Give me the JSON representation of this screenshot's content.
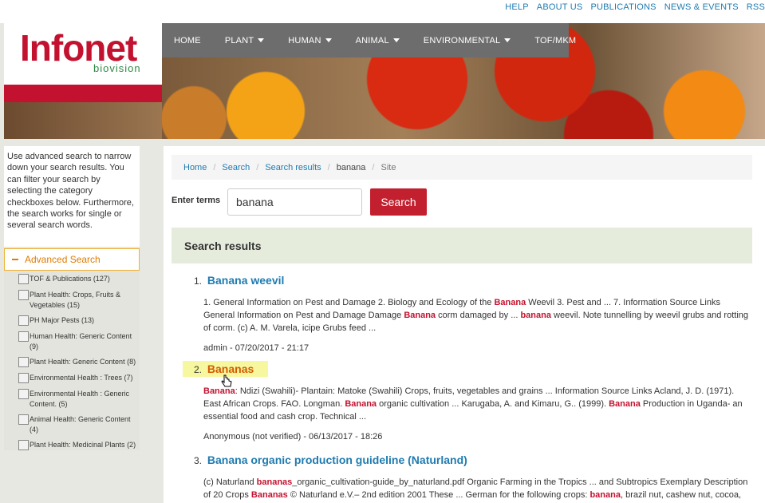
{
  "top_links": [
    "HELP",
    "ABOUT US",
    "PUBLICATIONS",
    "NEWS & EVENTS",
    "RSS"
  ],
  "logo": {
    "main": "Infonet",
    "sub": "biovision"
  },
  "nav": [
    {
      "label": "HOME",
      "dropdown": false
    },
    {
      "label": "PLANT",
      "dropdown": true
    },
    {
      "label": "HUMAN",
      "dropdown": true
    },
    {
      "label": "ANIMAL",
      "dropdown": true
    },
    {
      "label": "ENVIRONMENTAL",
      "dropdown": true
    },
    {
      "label": "TOF/MKM",
      "dropdown": false
    }
  ],
  "sidebar": {
    "intro": "Use advanced search to narrow down your search results. You can filter your search by selecting the category checkboxes below. Furthermore, the search works for single or several search words.",
    "advanced_label": "Advanced Search",
    "facets": [
      "TOF & Publications (127)",
      "Plant Health: Crops, Fruits & Vegetables (15)",
      "PH Major Pests (13)",
      "Human Health: Generic Content (9)",
      "Plant Health: Generic Content (8)",
      "Environmental Health : Trees (7)",
      "Environmental Health : Generic Content. (5)",
      "Animal Health: Generic Content (4)",
      "Plant Health: Medicinal Plants (2)"
    ]
  },
  "breadcrumb": {
    "home": "Home",
    "search": "Search",
    "results": "Search results",
    "term": "banana",
    "last": "Site"
  },
  "search": {
    "label": "Enter terms",
    "value": "banana",
    "button": "Search"
  },
  "results_heading": "Search results",
  "results": [
    {
      "num": "1.",
      "title": "Banana weevil",
      "meta": "admin - 07/20/2017 - 21:17"
    },
    {
      "num": "2.",
      "title": "Bananas",
      "meta": "Anonymous (not verified) - 06/13/2017 - 18:26"
    },
    {
      "num": "3.",
      "title": "Banana organic production guideline (Naturland)"
    }
  ],
  "snippets": {
    "r1": [
      "1. General Information on Pest and Damage 2. Biology and Ecology of the ",
      "Banana",
      " Weevil 3. Pest and ... 7. Information Source Links General Information on Pest and Damage Damage ",
      "Banana",
      " corm damaged by ... ",
      "banana",
      " weevil. Note tunnelling by weevil grubs and rotting of corm. (c) A. M. Varela, icipe Grubs feed ..."
    ],
    "r2": [
      "Banana",
      ": Ndizi (Swahili)- Plantain: Matoke (Swahili) Crops, fruits, vegetables and grains ... Information Source Links Acland, J. D. (1971). East African Crops. FAO. Longman. ",
      "Banana",
      " organic cultivation ... Karugaba, A. and Kimaru, G.. (1999). ",
      "Banana",
      " Production in Uganda- an essential food and cash crop. Technical ..."
    ],
    "r3": [
      "(c) Naturland ",
      "bananas",
      "_organic_cultivation-guide_by_naturland.pdf Organic Farming in the Tropics ... and Subtropics Exemplary Description of 20 Crops ",
      "Bananas",
      " © Naturland e.V.– 2nd edition 2001 These ... German for the following crops: ",
      "banana",
      ", brazil nut, cashew nut, cocoa,"
    ]
  }
}
